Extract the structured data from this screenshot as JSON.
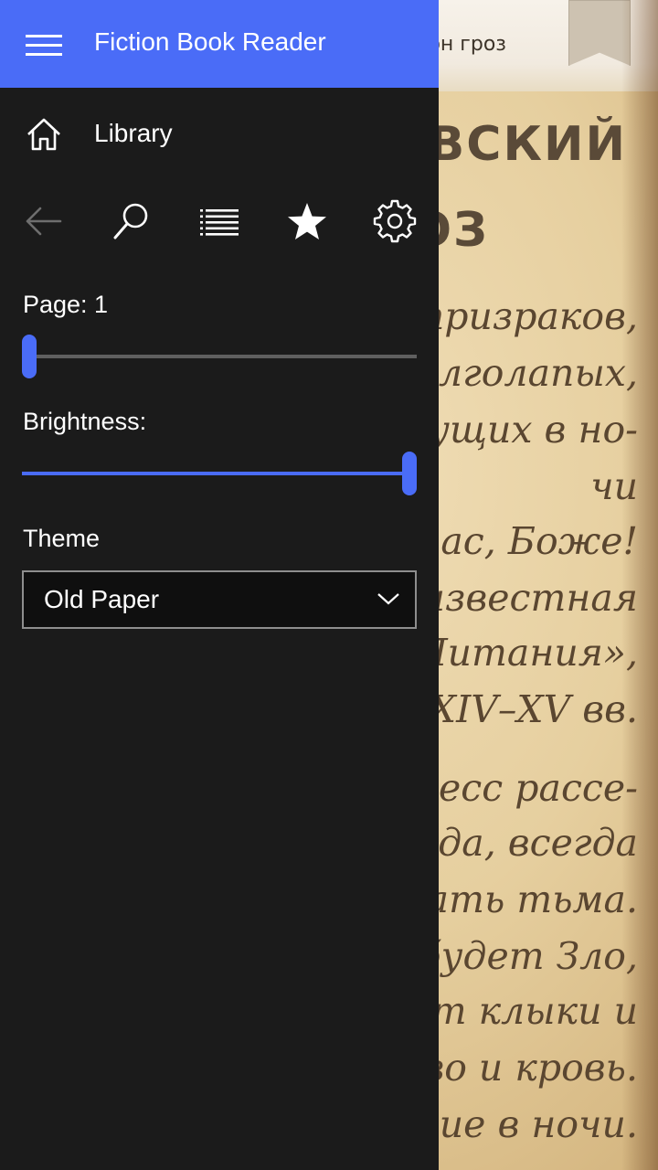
{
  "app": {
    "title": "Fiction Book Reader"
  },
  "nav": {
    "library_label": "Library",
    "toolbar": [
      {
        "name": "back-icon",
        "enabled": false
      },
      {
        "name": "search-icon",
        "enabled": true
      },
      {
        "name": "list-icon",
        "enabled": true
      },
      {
        "name": "star-icon",
        "enabled": true
      },
      {
        "name": "gear-icon",
        "enabled": true
      }
    ]
  },
  "settings": {
    "page_label": "Page: 1",
    "page_position": 0,
    "brightness_label": "Brightness:",
    "brightness_value": 1.0,
    "theme_label": "Theme",
    "theme_value": "Old Paper"
  },
  "colors": {
    "accent": "#4a6cf7",
    "pane_bg": "#1b1b1b",
    "paper": "#e6cf9f"
  },
  "reader": {
    "book_title_fragment": "он гроз",
    "heading_lines": [
      "ОВСКИЙ",
      "ОЗ"
    ],
    "text_lines": [
      "призраков,",
      "олголапых,",
      "ущих в но-",
      "чи",
      "нас, Боже!",
      "известная",
      "Литания»,",
      "XIV–XV вв.",
      "ресс рассе-",
      "еда, всегда",
      "ать тьма.",
      "будет Зло,",
      "т клыки и",
      "во и кровь.",
      "щие в ночи."
    ]
  }
}
